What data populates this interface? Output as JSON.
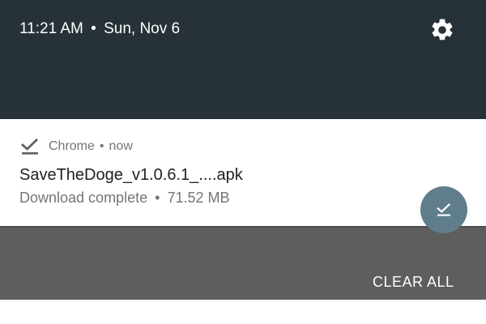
{
  "status_bar": {
    "time": "11:21 AM",
    "separator": "•",
    "date": "Sun, Nov 6",
    "settings_icon": "gear-icon"
  },
  "notification": {
    "app_name": "Chrome",
    "separator": "•",
    "time": "now",
    "app_icon": "download-done-icon",
    "title": "SaveTheDoge_v1.0.6.1_....apk",
    "status": "Download complete",
    "size": "71.52 MB",
    "action_icon": "download-done-icon",
    "action_color": "#607d8b"
  },
  "footer": {
    "clear_all_label": "CLEAR ALL"
  },
  "colors": {
    "header_bg": "#263238",
    "shade_bg": "#5e5e5e",
    "card_bg": "#ffffff"
  }
}
